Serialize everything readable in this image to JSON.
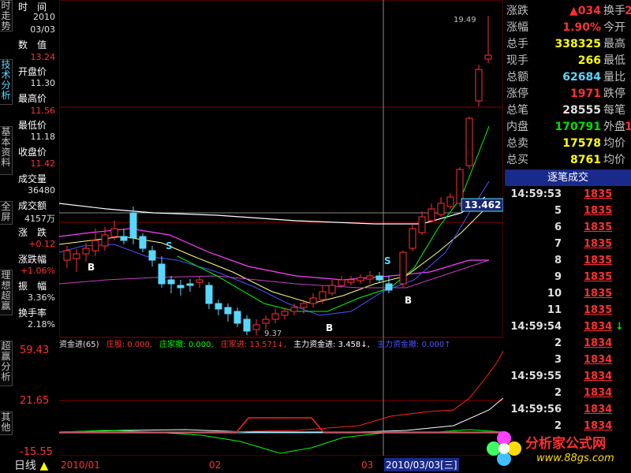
{
  "left_tabs": [
    {
      "label": "时走势",
      "active": false
    },
    {
      "label": "技术分析",
      "active": true
    },
    {
      "label": "基本资料",
      "active": false
    },
    {
      "label": "全屏",
      "active": false
    },
    {
      "label": "理想超赢",
      "active": false
    },
    {
      "label": "超赢分析",
      "active": false
    },
    {
      "label": "其他",
      "active": false
    }
  ],
  "info": {
    "time_label": "时　间",
    "year": "2010",
    "date": "03/03",
    "value_label": "数　值",
    "value": "13.24",
    "open_label": "开盘价",
    "open": "11.30",
    "high_label": "最高价",
    "high": "11.56",
    "low_label": "最低价",
    "low": "11.18",
    "close_label": "收盘价",
    "close": "11.42",
    "volume_label": "成交量",
    "volume": "36480",
    "amount_label": "成交额",
    "amount": "4157万",
    "change_label": "涨　跌",
    "change": "+0.12",
    "change_pct_label": "涨跌幅",
    "change_pct": "+1.06%",
    "amplitude_label": "振　幅",
    "amplitude": "3.36%",
    "turnover_label": "换手率",
    "turnover": "2.18%"
  },
  "chart": {
    "price_axis_high": "19.49",
    "price_axis_low": "9.37",
    "current_price_tag": "13.462",
    "signals": [
      "S",
      "S",
      "B",
      "B",
      "B",
      "B"
    ],
    "indicator_header": {
      "name": "资金进(65)",
      "l1": "庄股: 0.000,",
      "l2": "庄家撤: 0.000,",
      "l3": "庄家进: 13.571↓,",
      "l4": "主力资金进: 3.458↓,",
      "l5": "主力资金撤: 0.000↑"
    },
    "indicator_axis": [
      "59.43",
      "21.65",
      "-15.55"
    ],
    "date_labels": [
      "2010/01",
      "02",
      "03",
      "2010/03/03[三]"
    ],
    "period": "日线",
    "colors": {
      "up": "#ff3030",
      "down": "#5ad7ff",
      "ma5": "#ffffff",
      "ma10": "#ffff80",
      "ma20": "#ff40ff",
      "ma60": "#00ff00"
    }
  },
  "quote": {
    "rows": [
      {
        "l": "涨跌",
        "v": "▲034",
        "vc": "red",
        "l2": "换手",
        "v2": "2"
      },
      {
        "l": "涨幅",
        "v": "1.90%",
        "vc": "red",
        "l2": "今开",
        "v2": ""
      },
      {
        "l": "总手",
        "v": "338325",
        "vc": "yellow",
        "l2": "最高",
        "v2": ""
      },
      {
        "l": "现手",
        "v": "266",
        "vc": "yellow",
        "l2": "最低",
        "v2": ""
      },
      {
        "l": "总额",
        "v": "62684",
        "vc": "cyan",
        "l2": "量比",
        "v2": ""
      },
      {
        "l": "涨停",
        "v": "1971",
        "vc": "red",
        "l2": "跌停",
        "v2": ""
      },
      {
        "l": "总笔",
        "v": "28555",
        "vc": "white",
        "l2": "每笔",
        "v2": ""
      },
      {
        "l": "内盘",
        "v": "170791",
        "vc": "green",
        "l2": "外盘",
        "v2": "1"
      },
      {
        "l": "总卖",
        "v": "17578",
        "vc": "yellow",
        "l2": "均价",
        "v2": ""
      },
      {
        "l": "总买",
        "v": "8761",
        "vc": "yellow",
        "l2": "均价",
        "v2": ""
      }
    ],
    "ticks_title": "逐笔成交",
    "ticks": [
      {
        "t": "14:59:53",
        "p": "1835",
        "arrow": ""
      },
      {
        "t": "5",
        "p": "1835",
        "arrow": ""
      },
      {
        "t": "6",
        "p": "1835",
        "arrow": ""
      },
      {
        "t": "7",
        "p": "1835",
        "arrow": ""
      },
      {
        "t": "8",
        "p": "1835",
        "arrow": ""
      },
      {
        "t": "9",
        "p": "1835",
        "arrow": ""
      },
      {
        "t": "10",
        "p": "1835",
        "arrow": ""
      },
      {
        "t": "11",
        "p": "1835",
        "arrow": ""
      },
      {
        "t": "14:59:54",
        "p": "1834",
        "arrow": "↓"
      },
      {
        "t": "2",
        "p": "1834",
        "arrow": ""
      },
      {
        "t": "3",
        "p": "1834",
        "arrow": ""
      },
      {
        "t": "14:59:55",
        "p": "1834",
        "arrow": ""
      },
      {
        "t": "2",
        "p": "1834",
        "arrow": ""
      },
      {
        "t": "14:59:56",
        "p": "1834",
        "arrow": ""
      },
      {
        "t": "2",
        "p": "1834",
        "arrow": ""
      }
    ]
  },
  "watermark": {
    "name": "分析家公式网",
    "url": "www.88gs.com"
  }
}
